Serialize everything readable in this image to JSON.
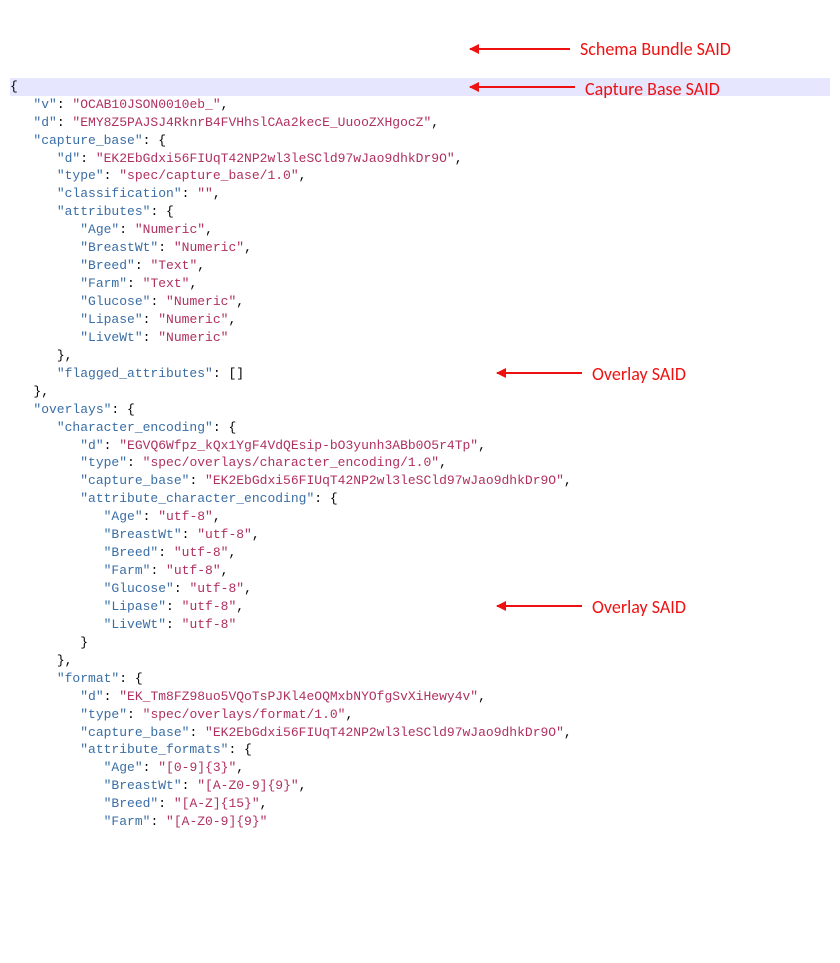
{
  "code": {
    "v_key": "\"v\"",
    "v_val": "\"OCAB10JSON0010eb_\"",
    "d_key": "\"d\"",
    "d_val": "\"EMY8Z5PAJSJ4RknrB4FVHhslCAa2kecE_UuooZXHgocZ\"",
    "cb_key": "\"capture_base\"",
    "cb_d_val": "\"EK2EbGdxi56FIUqT42NP2wl3leSCld97wJao9dhkDr9O\"",
    "type_key": "\"type\"",
    "cb_type_val": "\"spec/capture_base/1.0\"",
    "class_key": "\"classification\"",
    "class_val": "\"\"",
    "attr_key": "\"attributes\"",
    "age_key": "\"Age\"",
    "numeric_val": "\"Numeric\"",
    "breastwt_key": "\"BreastWt\"",
    "breed_key": "\"Breed\"",
    "text_val": "\"Text\"",
    "farm_key": "\"Farm\"",
    "glucose_key": "\"Glucose\"",
    "lipase_key": "\"Lipase\"",
    "livewt_key": "\"LiveWt\"",
    "flagged_key": "\"flagged_attributes\"",
    "overlays_key": "\"overlays\"",
    "charenc_key": "\"character_encoding\"",
    "ce_d_val": "\"EGVQ6Wfpz_kQx1YgF4VdQEsip-bO3yunh3ABb0O5r4Tp\"",
    "ce_type_val": "\"spec/overlays/character_encoding/1.0\"",
    "ce_cb_val": "\"EK2EbGdxi56FIUqT42NP2wl3leSCld97wJao9dhkDr9O\"",
    "ace_key": "\"attribute_character_encoding\"",
    "utf8_val": "\"utf-8\"",
    "format_key": "\"format\"",
    "fmt_d_val": "\"EK_Tm8FZ98uo5VQoTsPJKl4eOQMxbNYOfgSvXiHewy4v\"",
    "fmt_type_val": "\"spec/overlays/format/1.0\"",
    "fmt_cb_val": "\"EK2EbGdxi56FIUqT42NP2wl3leSCld97wJao9dhkDr9O\"",
    "af_key": "\"attribute_formats\"",
    "af_age_val": "\"[0-9]{3}\"",
    "af_breastwt_val": "\"[A-Z0-9]{9}\"",
    "af_breed_val": "\"[A-Z]{15}\"",
    "af_farm_val": "\"[A-Z0-9]{9}\""
  },
  "annotations": {
    "schema_bundle": "Schema Bundle SAID",
    "capture_base": "Capture Base SAID",
    "overlay": "Overlay SAID"
  }
}
